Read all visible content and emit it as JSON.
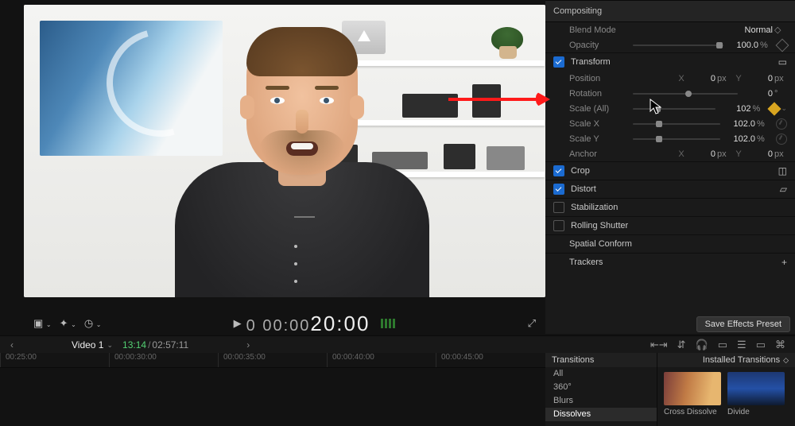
{
  "inspector": {
    "compositing_header": "Compositing",
    "blend_mode": {
      "label": "Blend Mode",
      "value": "Normal"
    },
    "opacity": {
      "label": "Opacity",
      "value": "100.0",
      "unit": "%"
    },
    "transform": {
      "header": "Transform",
      "position": {
        "label": "Position",
        "x": "0",
        "y": "0",
        "unit": "px"
      },
      "rotation": {
        "label": "Rotation",
        "value": "0",
        "unit": "°"
      },
      "scale_all": {
        "label": "Scale (All)",
        "value": "102",
        "unit": "%"
      },
      "scale_x": {
        "label": "Scale X",
        "value": "102.0",
        "unit": "%"
      },
      "scale_y": {
        "label": "Scale Y",
        "value": "102.0",
        "unit": "%"
      },
      "anchor": {
        "label": "Anchor",
        "x": "0",
        "y": "0",
        "unit": "px"
      }
    },
    "crop": "Crop",
    "distort": "Distort",
    "stabilization": "Stabilization",
    "rolling_shutter": "Rolling Shutter",
    "spatial_conform": "Spatial Conform",
    "trackers": "Trackers"
  },
  "viewer_controls": {
    "timecode_small": "0 00:00",
    "timecode_big": "20:00"
  },
  "save_preset": "Save Effects Preset",
  "strip": {
    "clip_name": "Video 1",
    "position": "13:14",
    "duration": "02:57:11"
  },
  "timeline": {
    "marks": [
      "00:25:00",
      "00:00:30:00",
      "00:00:35:00",
      "00:00:40:00",
      "00:00:45:00"
    ]
  },
  "browser": {
    "header": "Transitions",
    "right_header": "Installed Transitions",
    "categories": [
      "All",
      "360°",
      "Blurs",
      "Dissolves"
    ],
    "items": [
      {
        "name": "Cross Dissolve"
      },
      {
        "name": "Divide"
      }
    ]
  }
}
